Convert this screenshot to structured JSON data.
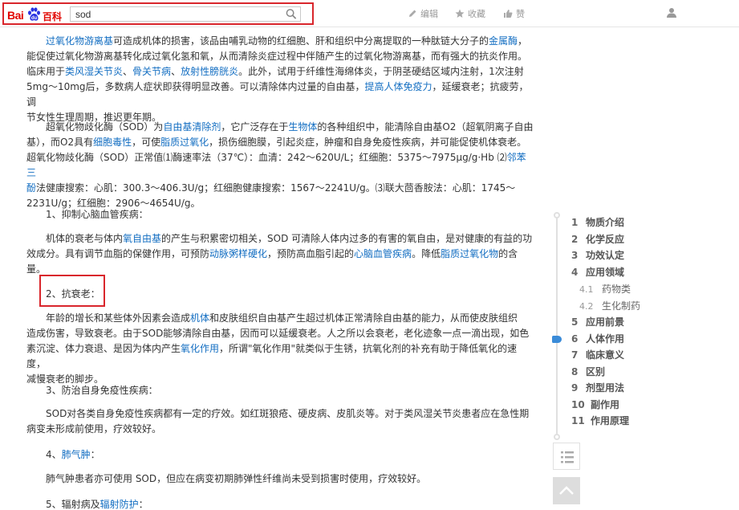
{
  "header": {
    "logo_bai": "Bai",
    "logo_baike": "百科",
    "search_value": "sod",
    "actions": {
      "edit": "编辑",
      "collect": "收藏",
      "like": "赞"
    }
  },
  "content": {
    "p1": {
      "l1_link1": "过氧化物游离基",
      "l1_t1": "可造成机体的损害，该品由哺乳动物的红细胞、肝和组织中分离提取的一种肽链大分子的",
      "l1_link2": "金属酶",
      "l1_t2": "，",
      "l2": "能促使过氧化物游离基转化成过氧化氢和氧，从而清除炎症过程中伴随产生的过氧化物游离基，而有强大的抗炎作用。",
      "l3_t1": "临床用于",
      "l3_link1": "类风湿关节炎",
      "l3_t2": "、",
      "l3_link2": "骨关节病",
      "l3_t3": "、",
      "l3_link3": "放射性膀胱炎",
      "l3_t4": "。此外，试用于纤维性海绵体炎，于阴茎硬结区域内注射，1次注射",
      "l4_t1": "5mg～10mg后，多数病人症状即获得明显改善。可以清除体内过量的自由基，",
      "l4_link1": "提高人体免疫力",
      "l4_t2": "，延缓衰老；抗疲劳，调",
      "l5": "节女性生理周期，推迟更年期。"
    },
    "p2": {
      "l1_t1": "超氧化物歧化酶（SOD）为",
      "l1_link1": "自由基清除剂",
      "l1_t2": "，它广泛存在于",
      "l1_link2": "生物体",
      "l1_t3": "的各种组织中，能清除自由基O2（超氧阴离子自由",
      "l2_t1": "基），而O2具有",
      "l2_link1": "细胞毒性",
      "l2_t2": "，可使",
      "l2_link2": "脂质过氧化",
      "l2_t3": "，损伤细胞膜，引起炎症，肿瘤和自身免疫性疾病，并可能促使机体衰老。",
      "l3_t1": "超氧化物歧化酶（SOD）正常值⑴酶速率法（37℃）：血清：242～620U/L；红细胞：5375～7975μg/g·Hb ⑵",
      "l3_link1": "邻苯三",
      "l4_link1": "酚",
      "l4_t1": "法健康搜索：心肌：300.3～406.3U/g；红细胞健康搜索：1567～2241U/g。⑶联大茴香胺法：心肌：1745～",
      "l5": "2231U/g；红细胞：2906～4654U/g。"
    },
    "h1": "1、抑制心脑血管疾病：",
    "p3": {
      "l1_t1": "机体的衰老与体内",
      "l1_link1": "氧自由基",
      "l1_t2": "的产生与积累密切相关，SOD 可清除人体内过多的有害的氧自由，是对健康的有益的功",
      "l2_t1": "效成分。具有调节血脂的保健作用，可预防",
      "l2_link1": "动脉粥样硬化",
      "l2_t2": "，预防高血脂引起的",
      "l2_link2": "心脑血管疾病",
      "l2_t3": "。降低",
      "l2_link3": "脂质过氧化物",
      "l2_t4": "的含",
      "l3": "量。"
    },
    "h2": "2、抗衰老：",
    "p4": {
      "l1_t1": "年龄的增长和某些体外因素会造成",
      "l1_link1": "机体",
      "l1_t2": "和皮肤组织自由基产生超过机体正常清除自由基的能力，从而使皮肤组织",
      "l2": "造成伤害，导致衰老。由于SOD能够清除自由基，因而可以延缓衰老。人之所以会衰老，老化迹象一点一滴出现，如色",
      "l3_t1": "素沉淀、体力衰退、是因为体内产生",
      "l3_link1": "氧化作用",
      "l3_t2": "，所谓\"氧化作用\"就类似于生锈，抗氧化剂的补充有助于降低氧化的速度，",
      "l4": "减慢衰老的脚步。"
    },
    "h3": "3、防治自身免疫性疾病：",
    "p5": {
      "l1": "SOD对各类自身免疫性疾病都有一定的疗效。如红斑狼疮、硬皮病、皮肌炎等。对于类风湿关节炎患者应在急性期",
      "l2": "病变未形成前使用，疗效较好。"
    },
    "h4_num": "4、",
    "h4_link": "肺气肿",
    "h4_t": "：",
    "p6": {
      "l1": "肺气肿患者亦可使用 SOD，但应在病变初期肺弹性纤维尚未受到损害时使用，疗效较好。"
    },
    "h5_t": "5、辐射病及",
    "h5_link": "辐射防护",
    "h5_t2": "："
  },
  "toc": {
    "items": [
      {
        "num": "1",
        "label": "物质介绍"
      },
      {
        "num": "2",
        "label": "化学反应"
      },
      {
        "num": "3",
        "label": "功效认定"
      },
      {
        "num": "4",
        "label": "应用领域"
      },
      {
        "num": "4.1",
        "label": "药物类"
      },
      {
        "num": "4.2",
        "label": "生化制药"
      },
      {
        "num": "5",
        "label": "应用前景"
      },
      {
        "num": "6",
        "label": "人体作用"
      },
      {
        "num": "7",
        "label": "临床意义"
      },
      {
        "num": "8",
        "label": "区别"
      },
      {
        "num": "9",
        "label": "剂型用法"
      },
      {
        "num": "10",
        "label": "副作用"
      },
      {
        "num": "11",
        "label": "作用原理"
      }
    ]
  },
  "colors": {
    "link": "#136ec2",
    "brand_red": "#e10602",
    "highlight_box": "#d9262c",
    "toc_active": "#3a8bd8"
  },
  "icons": {
    "edit": "pencil-icon",
    "collect": "star-icon",
    "like": "thumbs-up-icon",
    "user": "user-icon",
    "search": "search-icon",
    "toc_list": "list-icon",
    "back_top": "chevron-up-icon"
  }
}
